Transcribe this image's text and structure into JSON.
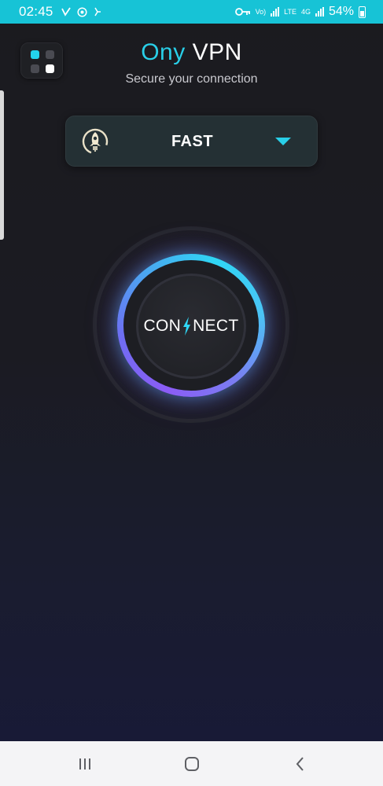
{
  "status_bar": {
    "time": "02:45",
    "left_icons": [
      "check-icon",
      "whatsapp-icon",
      "notification-icon"
    ],
    "network_labels": [
      "Vo)",
      "LTE",
      "4G"
    ],
    "battery": "54%"
  },
  "header": {
    "title_accent": "Ony",
    "title_rest": "VPN",
    "subtitle": "Secure your connection"
  },
  "server_selector": {
    "label": "FAST",
    "icon": "rocket-icon"
  },
  "connect_button": {
    "text_left": "CON",
    "text_right": "NECT",
    "icon": "bolt-icon"
  },
  "colors": {
    "accent": "#29cfe8",
    "status_bar": "#17c3d6",
    "ring_purple": "#8b5cf6"
  },
  "nav_bar": {
    "items": [
      "recents-icon",
      "home-icon",
      "back-icon"
    ]
  }
}
